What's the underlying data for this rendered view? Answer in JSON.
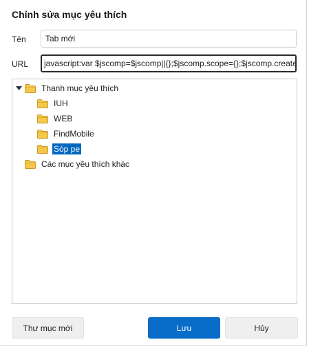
{
  "dialog": {
    "title": "Chỉnh sửa mục yêu thích",
    "name_label": "Tên",
    "name_value": "Tab mới",
    "url_label": "URL",
    "url_value": "javascript:var $jscomp=$jscomp||{};$jscomp.scope={};$jscomp.create"
  },
  "tree": {
    "root": {
      "label": "Thanh mục yêu thích",
      "icon": "folder-icon",
      "expanded": true
    },
    "children": [
      {
        "label": "IUH",
        "icon": "folder-icon"
      },
      {
        "label": "WEB",
        "icon": "folder-icon"
      },
      {
        "label": "FindMobile",
        "icon": "folder-icon"
      },
      {
        "label": "Sóp pe",
        "icon": "folder-icon",
        "selected": true
      }
    ],
    "other": {
      "label": "Các mục yêu thích khác",
      "icon": "folder-icon"
    }
  },
  "buttons": {
    "new_folder": "Thư mục mới",
    "save": "Lưu",
    "cancel": "Hủy"
  },
  "colors": {
    "accent": "#0a6cc9",
    "selection": "#0067c0",
    "folder_fill": "#f5c84c",
    "folder_stroke": "#c9992a"
  }
}
